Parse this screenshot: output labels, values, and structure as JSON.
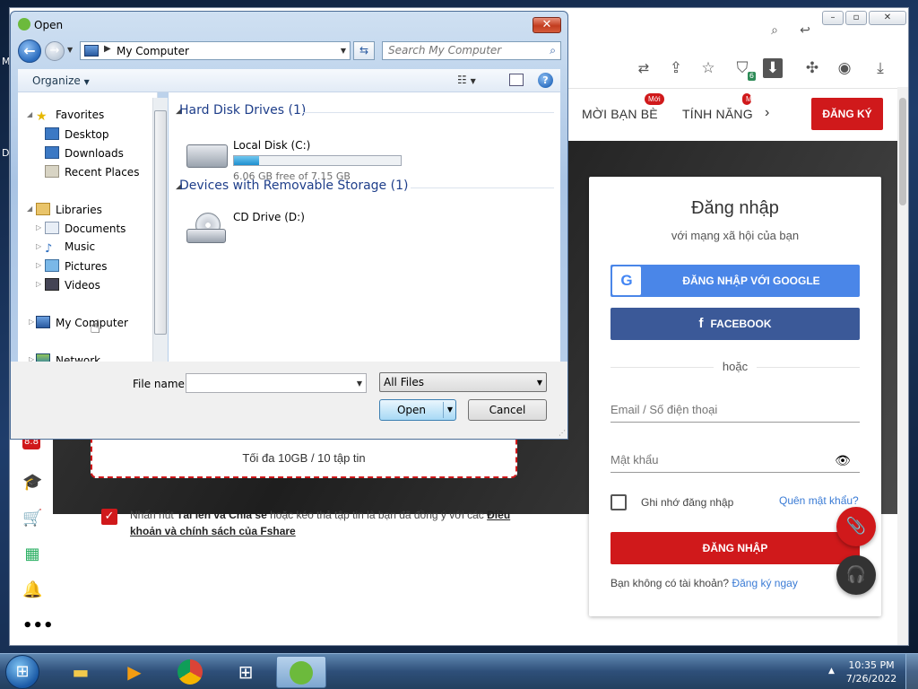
{
  "desktop": {
    "frag_top": "M",
    "frag_mid": "D"
  },
  "browser": {
    "toolbar": {
      "extension_badge": "6"
    },
    "nav": {
      "invite_label": "MỜI BẠN BÈ",
      "invite_badge": "Mới",
      "features_label": "TÍNH NĂNG",
      "register_label": "ĐĂNG KÝ"
    },
    "upload": {
      "limit_text": "Tối đa 10GB / 10 tập tin",
      "agree_prefix": "Nhấn nút ",
      "agree_bold": "Tải lên và Chia sẻ",
      "agree_middle": " hoặc kéo thả tập tin là bạn đã đồng ý với các ",
      "agree_link": "Điều khoản và chính sách của Fshare"
    },
    "login": {
      "title": "Đăng nhập",
      "subtitle": "với mạng xã hội của bạn",
      "google_label": "ĐĂNG NHẬP VỚI GOOGLE",
      "facebook_label": "FACEBOOK",
      "or_label": "hoặc",
      "email_placeholder": "Email / Số điện thoại",
      "password_placeholder": "Mật khẩu",
      "remember_label": "Ghi nhớ đăng nhập",
      "forgot_label": "Quên mật khẩu?",
      "submit_label": "ĐĂNG NHẬP",
      "no_account": "Bạn không có tài khoản? ",
      "signup_link": "Đăng ký ngay"
    },
    "colors": {
      "brand_red": "#d0191b",
      "google_blue": "#4a86e8",
      "facebook_blue": "#3b5998"
    }
  },
  "dialog": {
    "title": "Open",
    "address": "My Computer",
    "search_placeholder": "Search My Computer",
    "organize_label": "Organize",
    "nav": {
      "favorites": "Favorites",
      "desktop": "Desktop",
      "downloads": "Downloads",
      "recent_places": "Recent Places",
      "libraries": "Libraries",
      "documents": "Documents",
      "music": "Music",
      "pictures": "Pictures",
      "videos": "Videos",
      "my_computer": "My Computer",
      "network": "Network"
    },
    "groups": {
      "hard_disk": "Hard Disk Drives (1)",
      "removable": "Devices with Removable Storage (1)"
    },
    "drives": {
      "local_name": "Local Disk (C:)",
      "local_free": "6.06 GB free of 7.15 GB",
      "local_used_fraction": 0.152,
      "cd_name": "CD Drive (D:)"
    },
    "filename_label": "File name:",
    "filename_value": "",
    "filetype_value": "All Files",
    "open_label": "Open",
    "cancel_label": "Cancel"
  },
  "taskbar": {
    "time": "10:35 PM",
    "date": "7/26/2022"
  }
}
